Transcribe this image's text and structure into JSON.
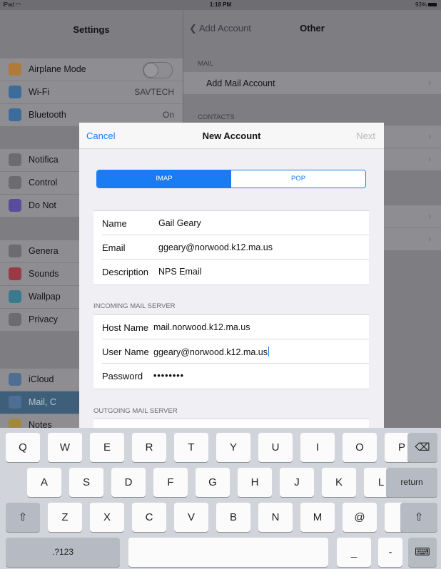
{
  "status": {
    "device": "iPad",
    "time": "1:18 PM",
    "battery": "93%"
  },
  "settings": {
    "title": "Settings",
    "groups": [
      [
        {
          "label": "Airplane Mode",
          "icon": "airplane-icon",
          "color": "#b07a3a",
          "toggle": true
        },
        {
          "label": "Wi-Fi",
          "icon": "wifi-icon",
          "color": "#3c6c9c",
          "value": "SAVTECH"
        },
        {
          "label": "Bluetooth",
          "icon": "bluetooth-icon",
          "color": "#3c6c9c",
          "value": "On"
        }
      ],
      [
        {
          "label": "Notifica",
          "icon": "notifications-icon",
          "color": "#6c6c70"
        },
        {
          "label": "Control",
          "icon": "control-center-icon",
          "color": "#6c6c70"
        },
        {
          "label": "Do Not",
          "icon": "moon-icon",
          "color": "#5a4c9a"
        }
      ],
      [
        {
          "label": "Genera",
          "icon": "gear-icon",
          "color": "#6c6c70"
        },
        {
          "label": "Sounds",
          "icon": "speaker-icon",
          "color": "#9a3a44"
        },
        {
          "label": "Wallpap",
          "icon": "wallpaper-icon",
          "color": "#3a7a8e"
        },
        {
          "label": "Privacy",
          "icon": "hand-icon",
          "color": "#6c6c70"
        }
      ],
      [
        {
          "label": "iCloud",
          "icon": "cloud-icon",
          "color": "#4e6e94"
        },
        {
          "label": "Mail, C",
          "icon": "mail-icon",
          "color": "#4e6e94",
          "selected": true
        },
        {
          "label": "Notes",
          "icon": "notes-icon",
          "color": "#a08a3a"
        }
      ]
    ]
  },
  "other": {
    "back": "Add Account",
    "title": "Other",
    "mail_header": "MAIL",
    "add_mail": "Add Mail Account",
    "contacts_header": "CONTACTS"
  },
  "modal": {
    "cancel": "Cancel",
    "title": "New Account",
    "next": "Next",
    "segments": [
      "IMAP",
      "POP"
    ],
    "account": [
      {
        "label": "Name",
        "value": "Gail Geary"
      },
      {
        "label": "Email",
        "value": "ggeary@norwood.k12.ma.us"
      },
      {
        "label": "Description",
        "value": "NPS Email"
      }
    ],
    "incoming_header": "INCOMING MAIL SERVER",
    "incoming": [
      {
        "label": "Host Name",
        "value": "mail.norwood.k12.ma.us"
      },
      {
        "label": "User Name",
        "value": "ggeary@norwood.k12.ma.us"
      },
      {
        "label": "Password",
        "value": "••••••••"
      }
    ],
    "outgoing_header": "OUTGOING MAIL SERVER"
  },
  "keyboard": {
    "row1": [
      "Q",
      "W",
      "E",
      "R",
      "T",
      "Y",
      "U",
      "I",
      "O",
      "P"
    ],
    "row2": [
      "A",
      "S",
      "D",
      "F",
      "G",
      "H",
      "J",
      "K",
      "L"
    ],
    "row3": [
      "Z",
      "X",
      "C",
      "V",
      "B",
      "N",
      "M",
      "@",
      "."
    ],
    "return": "return",
    "numbers": ".?123",
    "underscore": "_",
    "dash": "-"
  }
}
